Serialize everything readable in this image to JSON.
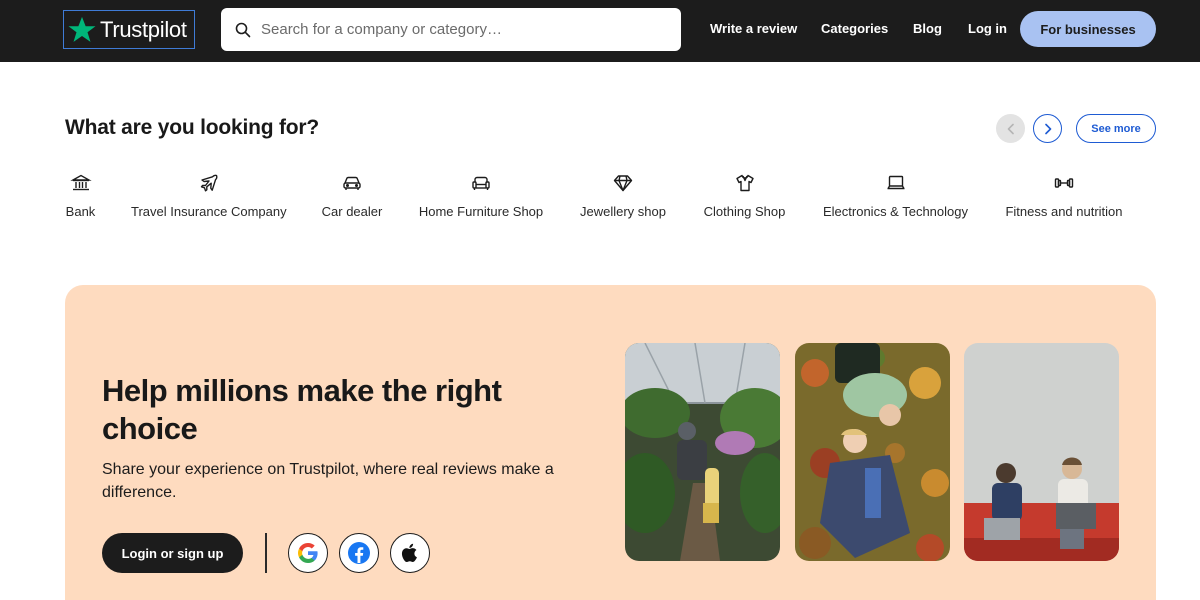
{
  "header": {
    "logo_text": "Trustpilot",
    "search_placeholder": "Search for a company or category…",
    "nav": [
      "Write a review",
      "Categories",
      "Blog",
      "Log in"
    ],
    "business_button": "For businesses"
  },
  "categories": {
    "title": "What are you looking for?",
    "see_more": "See more",
    "items": [
      {
        "label": "Bank",
        "icon": "bank-icon"
      },
      {
        "label": "Travel Insurance Company",
        "icon": "airplane-icon"
      },
      {
        "label": "Car dealer",
        "icon": "car-icon"
      },
      {
        "label": "Home Furniture Shop",
        "icon": "sofa-icon"
      },
      {
        "label": "Jewellery shop",
        "icon": "diamond-icon"
      },
      {
        "label": "Clothing Shop",
        "icon": "shirt-icon"
      },
      {
        "label": "Electronics & Technology",
        "icon": "laptop-icon"
      },
      {
        "label": "Fitness and nutrition",
        "icon": "dumbbell-icon"
      }
    ]
  },
  "promo": {
    "title": "Help millions make the right choice",
    "subtitle": "Share your experience on Trustpilot, where real reviews make a difference.",
    "login_button": "Login or sign up",
    "social": [
      "google-icon",
      "facebook-icon",
      "apple-icon"
    ],
    "photos": [
      "greenhouse-photo",
      "couple-on-leaves-photo",
      "people-with-laptops-photo"
    ]
  },
  "colors": {
    "header_bg": "#1c1c1c",
    "brand_star": "#00b67a",
    "business_btn": "#a9c2f2",
    "promo_bg": "#fedbbf",
    "link_blue": "#1e5bd3"
  }
}
